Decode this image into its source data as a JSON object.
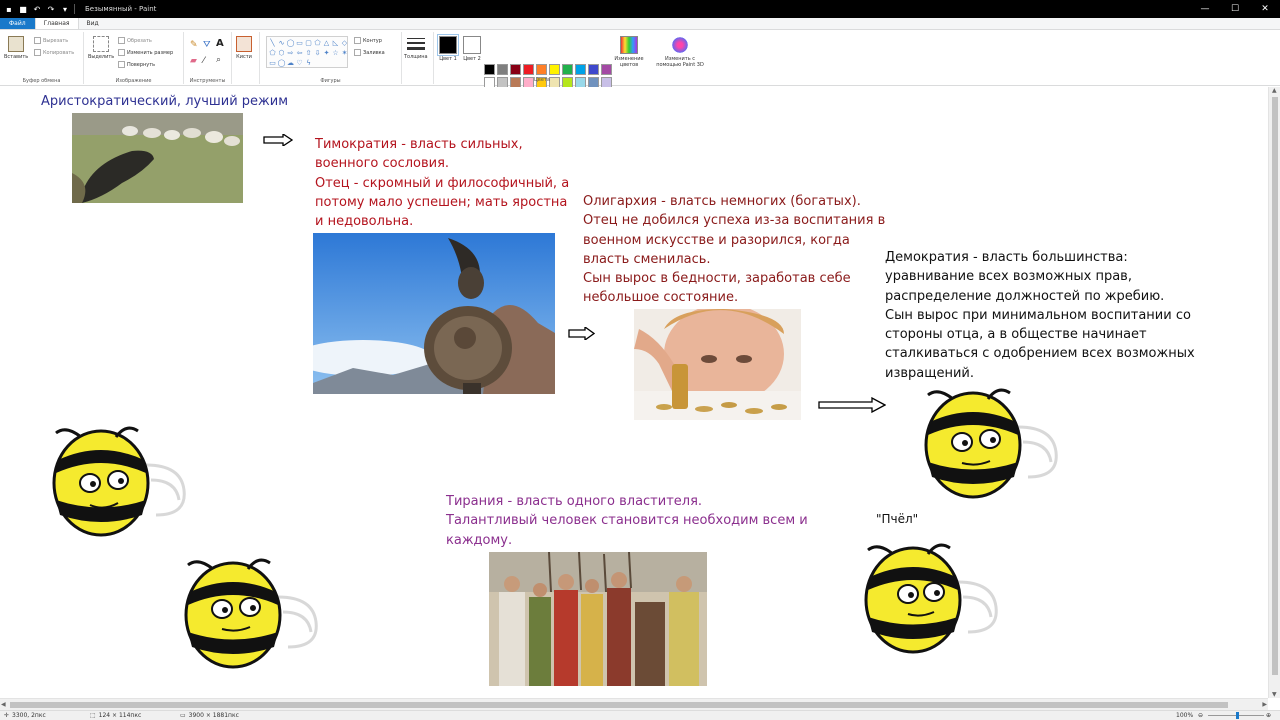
{
  "window": {
    "title": "Безымянный - Paint"
  },
  "tabs": [
    {
      "label": "Файл"
    },
    {
      "label": "Главная"
    },
    {
      "label": "Вид"
    }
  ],
  "ribbon": {
    "clipboard": {
      "label": "Буфер обмена",
      "paste": "Вставить",
      "cut": "Вырезать",
      "copy": "Копировать"
    },
    "image": {
      "label": "Изображение",
      "select": "Выделить",
      "crop": "Обрезать",
      "resize": "Изменить размер",
      "rotate": "Повернуть"
    },
    "tools": {
      "label": "Инструменты"
    },
    "brushes": {
      "label": "Кисти"
    },
    "shapes": {
      "label": "Фигуры",
      "outline": "Контур",
      "fill": "Заливка"
    },
    "size": {
      "label": "Толщина"
    },
    "colors": {
      "label": "Цвета",
      "color1": "Цвет 1",
      "color2": "Цвет 2",
      "edit": "Изменение цветов",
      "paint3d": "Изменить с помощью Paint 3D",
      "swatches": [
        "#000000",
        "#7f7f7f",
        "#880015",
        "#ed1c24",
        "#ff7f27",
        "#fff200",
        "#22b14c",
        "#00a2e8",
        "#3f48cc",
        "#a349a4",
        "#ffffff",
        "#c3c3c3",
        "#b97a57",
        "#ffaec9",
        "#ffc90e",
        "#efe4b0",
        "#b5e61d",
        "#99d9ea",
        "#7092be",
        "#c8bfe7",
        "#ffffff",
        "#ffffff",
        "#ffffff",
        "#ffffff",
        "#ffffff",
        "#ffffff",
        "#ffffff",
        "#ffffff",
        "#ffffff",
        "#ffffff"
      ]
    }
  },
  "canvas": {
    "aristocracy_title": "Аристократический, лучший режим",
    "timocracy": [
      "Тимократия - власть сильных,",
      "военного сословия.",
      "Отец - скромный и философичный, а",
      "потому мало успешен; мать яростна",
      "и недовольна."
    ],
    "oligarchy": [
      "Олигархия - влатсь немногих (богатых).",
      "Отец не добился успеха из-за воспитания в",
      "военном искусстве и разорился, когда",
      "власть сменилась.",
      "Сын вырос в бедности, заработав себе",
      "небольшое состояние."
    ],
    "democracy": [
      "Демократия - власть большинства:",
      "уравнивание всех возможных прав,",
      "распределение должностей по жребию.",
      "Сын вырос при минимальном воспитании со",
      "стороны отца, а в обществе начинает",
      "сталкиваться с одобрением всех возможных",
      "извращений."
    ],
    "tyranny": [
      "Тирания - власть одного властителя.",
      "Талантливый человек становится необходим всем и",
      "каждому."
    ],
    "bee_label": "\"Пчёл\""
  },
  "status": {
    "position": "3300, 2пкс",
    "selection": "124 × 114пкс",
    "canvas_size": "3900 × 1881пкс",
    "zoom": "100%"
  }
}
